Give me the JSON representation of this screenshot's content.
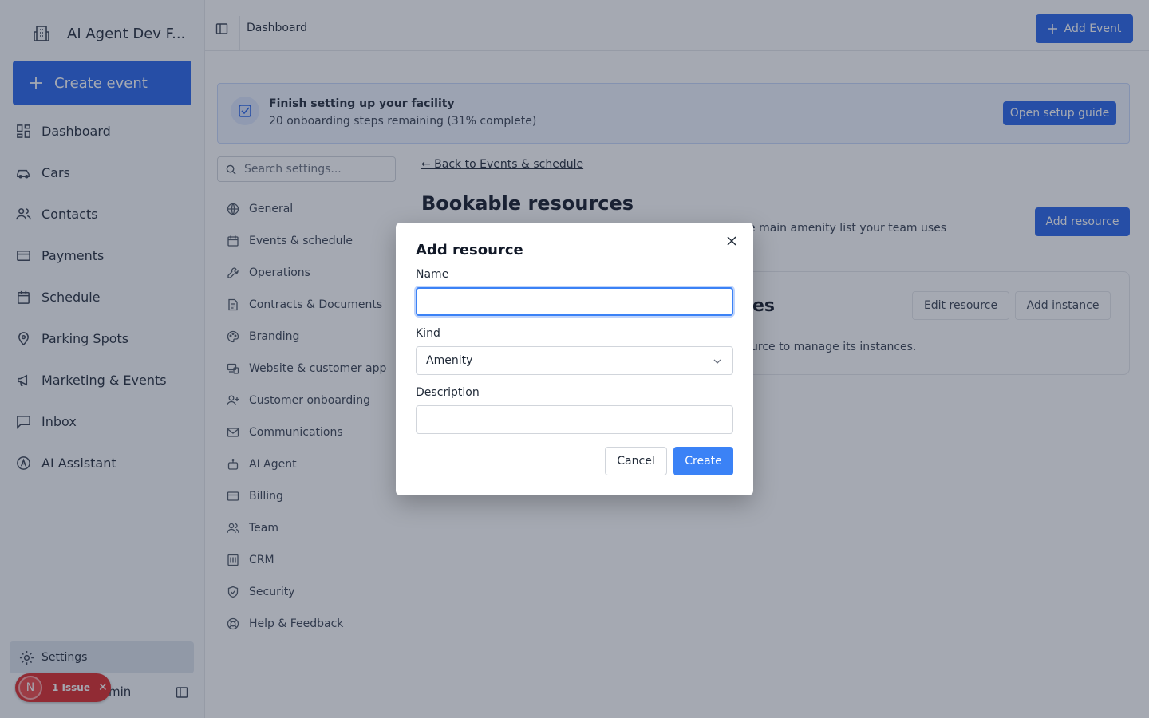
{
  "sidebar": {
    "brand_name": "AI Agent Dev F...",
    "create_label": "Create event",
    "items": [
      {
        "label": "Dashboard",
        "icon": "dashboard-icon"
      },
      {
        "label": "Cars",
        "icon": "car-icon"
      },
      {
        "label": "Contacts",
        "icon": "users-icon"
      },
      {
        "label": "Payments",
        "icon": "credit-card-icon"
      },
      {
        "label": "Schedule",
        "icon": "calendar-icon"
      },
      {
        "label": "Parking Spots",
        "icon": "map-pin-icon"
      },
      {
        "label": "Marketing & Events",
        "icon": "megaphone-icon"
      },
      {
        "label": "Inbox",
        "icon": "message-square-icon"
      },
      {
        "label": "AI Assistant",
        "icon": "ai-assistant-icon"
      }
    ],
    "settings_label": "Settings",
    "user_label_fragment": "min",
    "issue": {
      "avatar_letter": "N",
      "label": "1 Issue",
      "close": "✕"
    }
  },
  "topbar": {
    "breadcrumb": "Dashboard",
    "add_event_label": "Add Event"
  },
  "banner": {
    "title": "Finish setting up your facility",
    "subtitle": "20 onboarding steps remaining (31% complete)",
    "button_label": "Open setup guide"
  },
  "settings_nav": {
    "search_placeholder": "Search settings...",
    "items": [
      {
        "label": "General",
        "icon": "globe-icon"
      },
      {
        "label": "Events & schedule",
        "icon": "calendar-icon"
      },
      {
        "label": "Operations",
        "icon": "wrench-icon"
      },
      {
        "label": "Contracts & Documents",
        "icon": "file-text-icon"
      },
      {
        "label": "Branding",
        "icon": "palette-icon"
      },
      {
        "label": "Website & customer app",
        "icon": "devices-icon"
      },
      {
        "label": "Customer onboarding",
        "icon": "user-plus-icon"
      },
      {
        "label": "Communications",
        "icon": "mail-icon"
      },
      {
        "label": "AI Agent",
        "icon": "bot-icon"
      },
      {
        "label": "Billing",
        "icon": "credit-card-icon"
      },
      {
        "label": "Team",
        "icon": "users-icon"
      },
      {
        "label": "CRM",
        "icon": "crm-icon"
      },
      {
        "label": "Security",
        "icon": "shield-icon"
      },
      {
        "label": "Help & Feedback",
        "icon": "life-buoy-icon"
      }
    ]
  },
  "main": {
    "back_link": "← Back to Events & schedule",
    "title": "Bookable resources",
    "description_fragment": "e main amenity list your team uses",
    "add_resource_label": "Add resource",
    "card": {
      "title_fragment": "es",
      "edit_label": "Edit resource",
      "add_instance_label": "Add instance",
      "hint_fragment": "urce to manage its instances."
    }
  },
  "modal": {
    "title": "Add resource",
    "name_label": "Name",
    "name_value": "",
    "kind_label": "Kind",
    "kind_value": "Amenity",
    "description_label": "Description",
    "description_value": "",
    "cancel_label": "Cancel",
    "create_label": "Create"
  },
  "colors": {
    "accent": "#2563eb",
    "modal_primary": "#3b82f6",
    "issue_badge": "#dc2626"
  }
}
